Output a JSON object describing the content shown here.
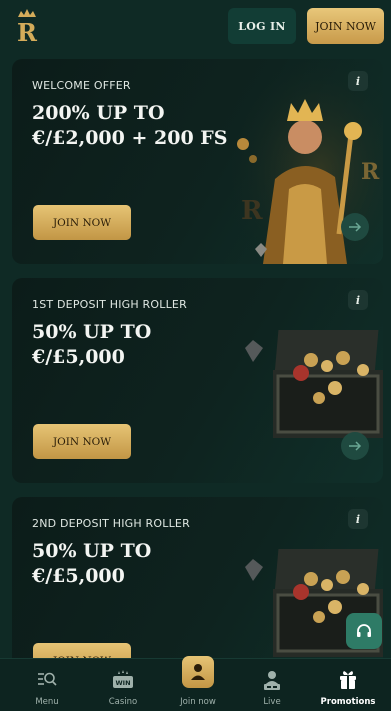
{
  "header": {
    "login_label": "LOG IN",
    "join_label": "JOIN NOW"
  },
  "cards": [
    {
      "label": "WELCOME OFFER",
      "title_line1": "200% UP TO",
      "title_line2": "€/£2,000 + 200 FS",
      "cta_label": "JOIN NOW",
      "info_icon": "i"
    },
    {
      "label": "1ST DEPOSIT HIGH ROLLER",
      "title_line1": "50% UP TO",
      "title_line2": "€/£5,000",
      "cta_label": "JOIN NOW",
      "info_icon": "i"
    },
    {
      "label": "2ND DEPOSIT HIGH ROLLER",
      "title_line1": "50% UP TO",
      "title_line2": "€/£5,000",
      "cta_label": "JOIN NOW",
      "info_icon": "i"
    }
  ],
  "nav": {
    "items": [
      {
        "label": "Menu",
        "icon": "menu-search-icon"
      },
      {
        "label": "Casino",
        "icon": "casino-win-icon"
      },
      {
        "label": "Join now",
        "icon": "user-icon"
      },
      {
        "label": "Live",
        "icon": "live-dealer-icon"
      },
      {
        "label": "Promotions",
        "icon": "gift-icon"
      }
    ],
    "active": "Promotions"
  },
  "colors": {
    "background": "#0f2a25",
    "gold": "#d4ac5a",
    "login_bg": "#123d35",
    "support_bg": "#2e7b66"
  }
}
